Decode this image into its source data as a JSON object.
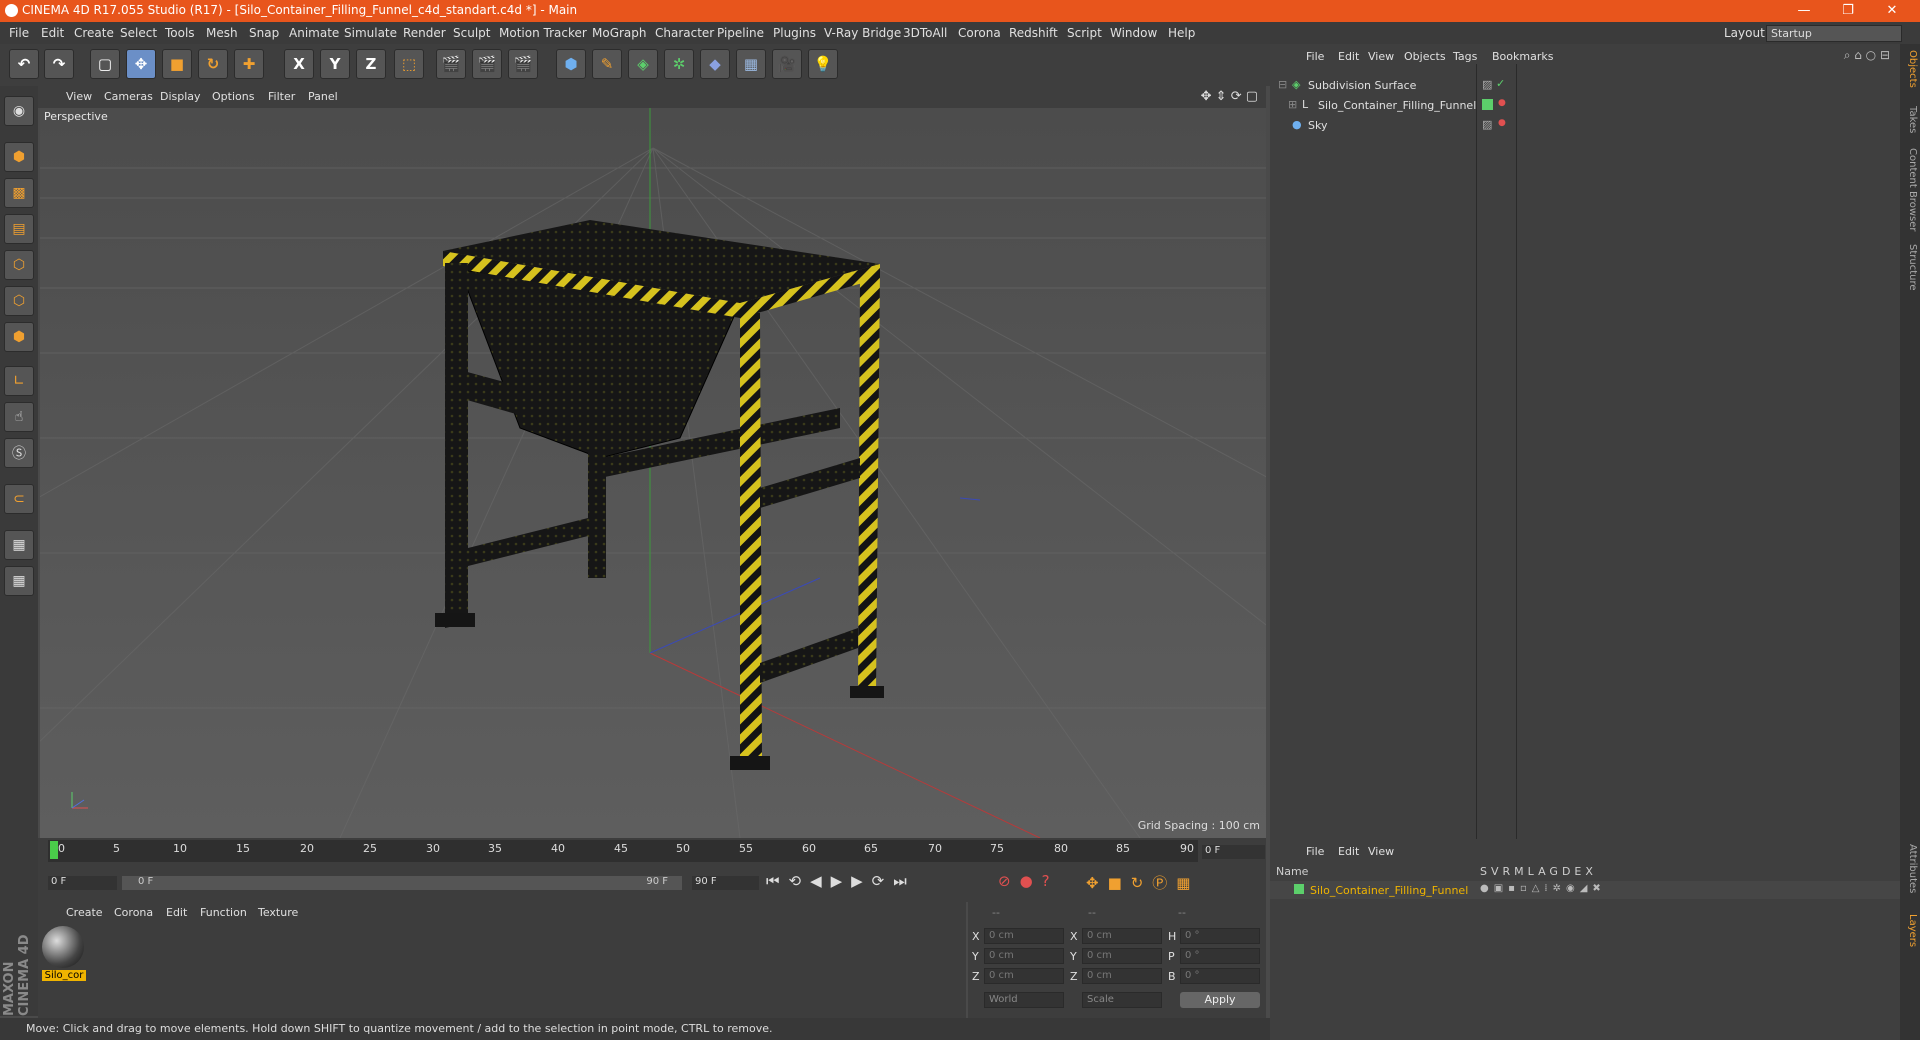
{
  "window": {
    "title": "CINEMA 4D R17.055 Studio (R17) - [Silo_Container_Filling_Funnel_c4d_standart.c4d *] - Main",
    "min": "—",
    "max": "❐",
    "close": "✕"
  },
  "menu": [
    "File",
    "Edit",
    "Create",
    "Select",
    "Tools",
    "Mesh",
    "Snap",
    "Animate",
    "Simulate",
    "Render",
    "Sculpt",
    "Motion Tracker",
    "MoGraph",
    "Character",
    "Pipeline",
    "Plugins",
    "V-Ray Bridge",
    "3DToAll",
    "Corona",
    "Redshift",
    "Script",
    "Window",
    "Help"
  ],
  "layout": {
    "label": "Layout:",
    "value": "Startup"
  },
  "toolbar": {
    "x": "X",
    "y": "Y",
    "z": "Z"
  },
  "viewport": {
    "menu": [
      "View",
      "Cameras",
      "Display",
      "Options",
      "Filter",
      "Panel"
    ],
    "camera": "Perspective",
    "grid_spacing": "Grid Spacing : 100 cm"
  },
  "timeline": {
    "ticks": [
      "0",
      "5",
      "10",
      "15",
      "20",
      "25",
      "30",
      "35",
      "40",
      "45",
      "50",
      "55",
      "60",
      "65",
      "70",
      "75",
      "80",
      "85",
      "90"
    ],
    "current_frame": "0 F",
    "start": "0 F",
    "range_start": "0 F",
    "range_end": "90 F",
    "end": "90 F"
  },
  "materials": {
    "menu": [
      "Create",
      "Corona",
      "Edit",
      "Function",
      "Texture"
    ],
    "material_name": "Silo_cor"
  },
  "coords": {
    "head": [
      "--",
      "--",
      "--"
    ],
    "labels": [
      "X",
      "Y",
      "Z",
      "X",
      "Y",
      "Z",
      "H",
      "P",
      "B"
    ],
    "values": [
      "0 cm",
      "0 cm",
      "0 cm",
      "0 cm",
      "0 cm",
      "0 cm",
      "0 °",
      "0 °",
      "0 °"
    ],
    "world": "World",
    "scale": "Scale",
    "apply": "Apply"
  },
  "status": "Move: Click and drag to move elements. Hold down SHIFT to quantize movement / add to the selection in point mode, CTRL to remove.",
  "objects": {
    "menu": [
      "File",
      "Edit",
      "View",
      "Objects",
      "Tags",
      "Bookmarks"
    ],
    "items": [
      "Subdivision Surface",
      "Silo_Container_Filling_Funnel",
      "Sky"
    ]
  },
  "layers": {
    "menu": [
      "File",
      "Edit",
      "View"
    ],
    "name_header": "Name",
    "cols": [
      "S",
      "V",
      "R",
      "M",
      "L",
      "A",
      "G",
      "D",
      "E",
      "X"
    ],
    "item": "Silo_Container_Filling_Funnel"
  },
  "side_tabs": [
    "Objects",
    "Takes",
    "Content Browser",
    "Structure",
    "Attributes",
    "Layers"
  ],
  "brand": "MAXON CINEMA 4D",
  "colors": {
    "titlebar": "#e8551c",
    "accent": "#6b8fc7",
    "material_label": "#f0b400"
  }
}
